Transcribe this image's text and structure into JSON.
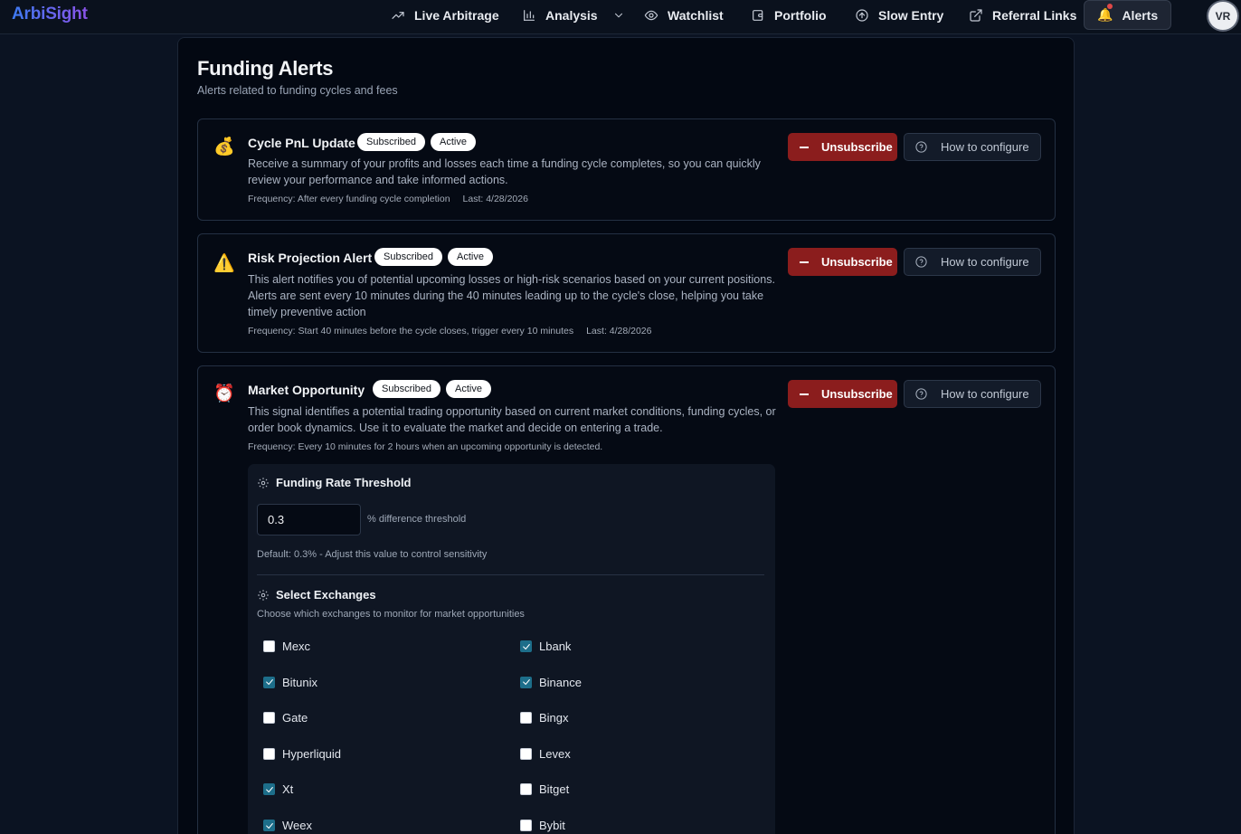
{
  "app": {
    "brand": "ArbiSight",
    "avatar_initials": "VR"
  },
  "nav": [
    {
      "label": "Live Arbitrage",
      "icon": "trending-up-icon"
    },
    {
      "label": "Analysis",
      "icon": "bar-chart-icon",
      "has_dropdown": true
    },
    {
      "label": "Watchlist",
      "icon": "eye-icon"
    },
    {
      "label": "Portfolio",
      "icon": "wallet-icon"
    },
    {
      "label": "Slow Entry",
      "icon": "arrow-up-circle-icon"
    },
    {
      "label": "Referral Links",
      "icon": "external-link-icon"
    },
    {
      "label": "Alerts",
      "icon": "bell-icon",
      "active": true
    }
  ],
  "page": {
    "title": "Funding Alerts",
    "subtitle": "Alerts related to funding cycles and fees"
  },
  "alerts": [
    {
      "name": "Cycle PnL Update",
      "emoji": "💰",
      "badges": [
        "Subscribed",
        "Active"
      ],
      "description": "Receive a summary of your profits and losses each time a funding cycle completes, so you can quickly review your performance and take informed actions.",
      "frequency": "Frequency: After every funding cycle completion",
      "last": "Last: 4/28/2026",
      "unsubscribe_label": "Unsubscribe",
      "how_label": "How to configure"
    },
    {
      "name": "Risk Projection Alert",
      "emoji": "⚠️",
      "badges": [
        "Subscribed",
        "Active"
      ],
      "description": "This alert notifies you of potential upcoming losses or high-risk scenarios based on your current positions. Alerts are sent every 10 minutes during the 40 minutes leading up to the cycle's close, helping you take timely preventive action",
      "frequency": "Frequency: Start 40 minutes before the cycle closes, trigger every 10 minutes",
      "last": "Last: 4/28/2026",
      "unsubscribe_label": "Unsubscribe",
      "how_label": "How to configure"
    },
    {
      "name": "Market Opportunity",
      "emoji": "⏰",
      "badges": [
        "Subscribed",
        "Active"
      ],
      "description": "This signal identifies a potential trading opportunity based on current market conditions, funding cycles, or order book dynamics. Use it to evaluate the market and decide on entering a trade.",
      "frequency": "Frequency: Every 10 minutes for 2 hours when an upcoming opportunity is detected.",
      "unsubscribe_label": "Unsubscribe",
      "how_label": "How to configure"
    }
  ],
  "config": {
    "threshold_title": "Funding Rate Threshold",
    "threshold_value": "0.3",
    "threshold_label": "% difference threshold",
    "threshold_note": "Default: 0.3% - Adjust this value to control sensitivity",
    "exchanges_title": "Select Exchanges",
    "exchanges_note": "Choose which exchanges to monitor for market opportunities",
    "exchanges": [
      {
        "name": "Mexc",
        "checked": false
      },
      {
        "name": "Lbank",
        "checked": true
      },
      {
        "name": "Bitunix",
        "checked": true
      },
      {
        "name": "Binance",
        "checked": true
      },
      {
        "name": "Gate",
        "checked": false
      },
      {
        "name": "Bingx",
        "checked": false
      },
      {
        "name": "Hyperliquid",
        "checked": false
      },
      {
        "name": "Levex",
        "checked": false
      },
      {
        "name": "Xt",
        "checked": true
      },
      {
        "name": "Bitget",
        "checked": false
      },
      {
        "name": "Weex",
        "checked": true
      },
      {
        "name": "Bybit",
        "checked": false
      }
    ]
  }
}
